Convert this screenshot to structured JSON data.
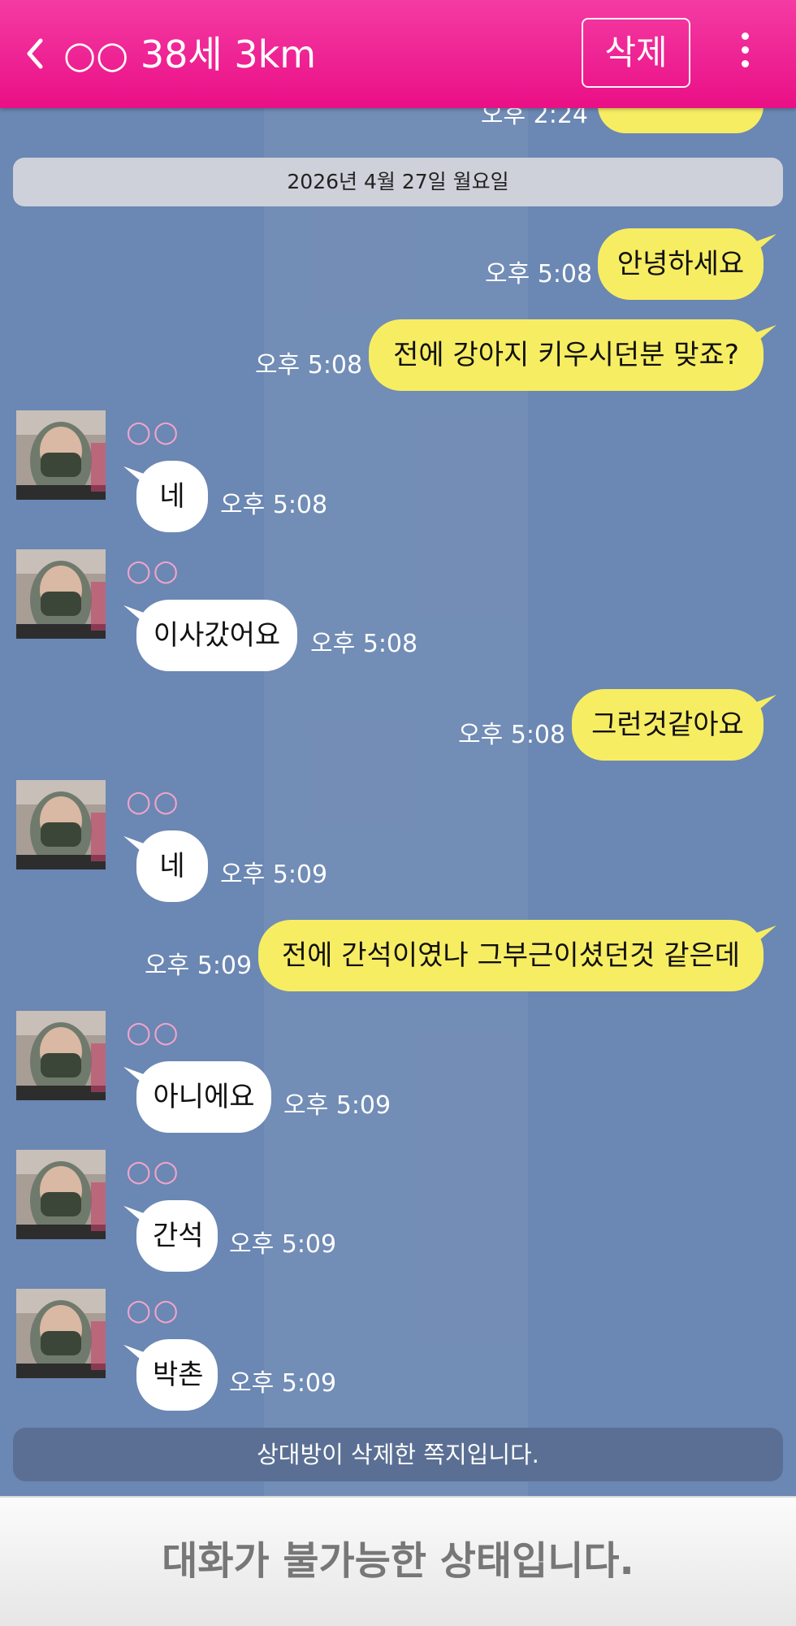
{
  "header": {
    "title": "○○ 38세 3km",
    "delete_label": "삭제",
    "back_icon": "chevron-left-icon",
    "more_icon": "more-vertical-icon"
  },
  "partial_top_time": "오후 2:24",
  "date_divider": "2026년 4월 27일 월요일",
  "sender_name": "○○",
  "messages": [
    {
      "from": "me",
      "text": "안녕하세요",
      "time": "오후 5:08"
    },
    {
      "from": "me",
      "text": "전에 강아지 키우시던분  맞죠?",
      "time": "오후 5:08"
    },
    {
      "from": "them",
      "text": "네",
      "time": "오후 5:08"
    },
    {
      "from": "them",
      "text": "이사갔어요",
      "time": "오후 5:08"
    },
    {
      "from": "me",
      "text": "그런것같아요",
      "time": "오후 5:08"
    },
    {
      "from": "them",
      "text": "네",
      "time": "오후 5:09"
    },
    {
      "from": "me",
      "text": "전에 간석이였나 그부근이셨던것 같은데",
      "time": "오후 5:09"
    },
    {
      "from": "them",
      "text": "아니에요",
      "time": "오후 5:09"
    },
    {
      "from": "them",
      "text": "간석",
      "time": "오후 5:09"
    },
    {
      "from": "them",
      "text": "박촌",
      "time": "오후 5:09"
    }
  ],
  "deleted_notice": "상대방이 삭제한 쪽지입니다.",
  "footer_text": "대화가 불가능한 상태입니다.",
  "colors": {
    "header": "#ea0f86",
    "background": "#6b87b3",
    "my_bubble": "#f7ed63",
    "their_bubble": "#ffffff",
    "sender_name": "#f0a4c9"
  }
}
